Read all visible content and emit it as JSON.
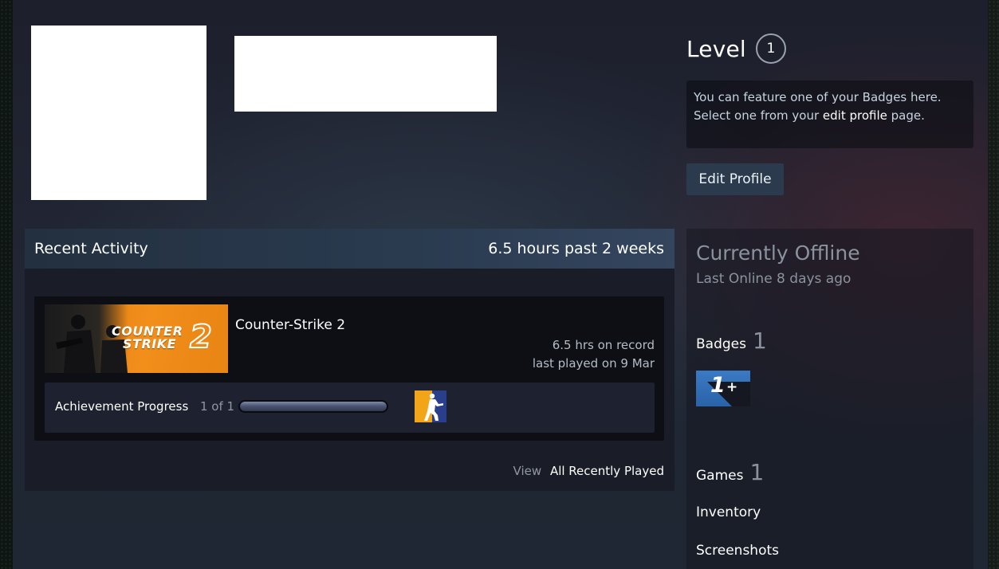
{
  "profile": {
    "level_label": "Level",
    "level_value": "1",
    "badge_hint_line1": "You can feature one of your Badges here.",
    "badge_hint_line2_pre": "Select one from your ",
    "badge_hint_link": "edit profile",
    "badge_hint_line2_post": " page.",
    "edit_button": "Edit Profile"
  },
  "recent_activity": {
    "title": "Recent Activity",
    "hours_summary": "6.5 hours past 2 weeks",
    "games": [
      {
        "name": "Counter-Strike 2",
        "capsule_text_line1": "COUNTER",
        "capsule_text_line2": "STRIKE",
        "capsule_number": "2",
        "hours_on_record": "6.5 hrs on record",
        "last_played": "last played on 9 Mar",
        "achievement_label": "Achievement Progress",
        "achievement_count": "1 of 1",
        "achievement_progress": 1.0
      }
    ],
    "view_label": "View",
    "view_link": "All Recently Played"
  },
  "side": {
    "status": "Currently Offline",
    "last_online": "Last Online 8 days ago",
    "badges_label": "Badges",
    "badges_count": "1",
    "badge_text": "1",
    "badge_plus": "+",
    "games_label": "Games",
    "games_count": "1",
    "inventory_label": "Inventory",
    "screenshots_label": "Screenshots"
  },
  "colors": {
    "accent_orange": "#f28e1a",
    "panel_header": "#2a3b50",
    "text_white": "#ffffff",
    "text_muted": "#8a939d"
  }
}
